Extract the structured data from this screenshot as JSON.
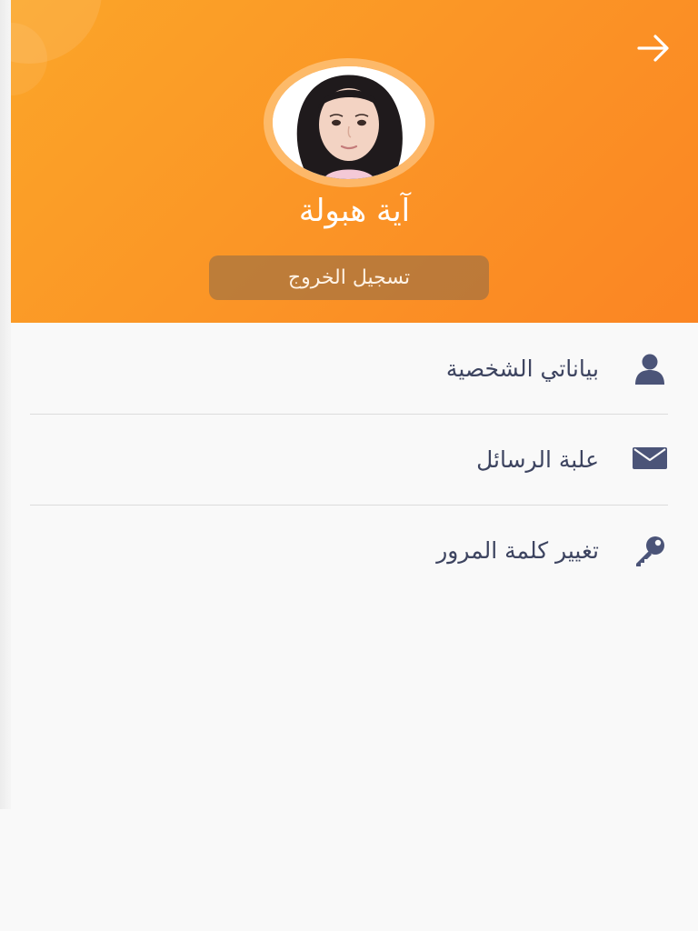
{
  "header": {
    "back_icon": "arrow-right-icon",
    "gradient_start": "#fba528",
    "gradient_end": "#fb8523"
  },
  "profile": {
    "name": "آية هبولة",
    "avatar_alt": "profile photo"
  },
  "logout": {
    "label": "تسجيل الخروج"
  },
  "menu": {
    "items": [
      {
        "label": "بياناتي الشخصية",
        "icon": "user-icon"
      },
      {
        "label": "علبة الرسائل",
        "icon": "envelope-icon"
      },
      {
        "label": "تغيير كلمة المرور",
        "icon": "key-icon"
      }
    ]
  },
  "colors": {
    "icon": "#4b5478",
    "text": "#3d4460",
    "background": "#f9f9f9"
  }
}
